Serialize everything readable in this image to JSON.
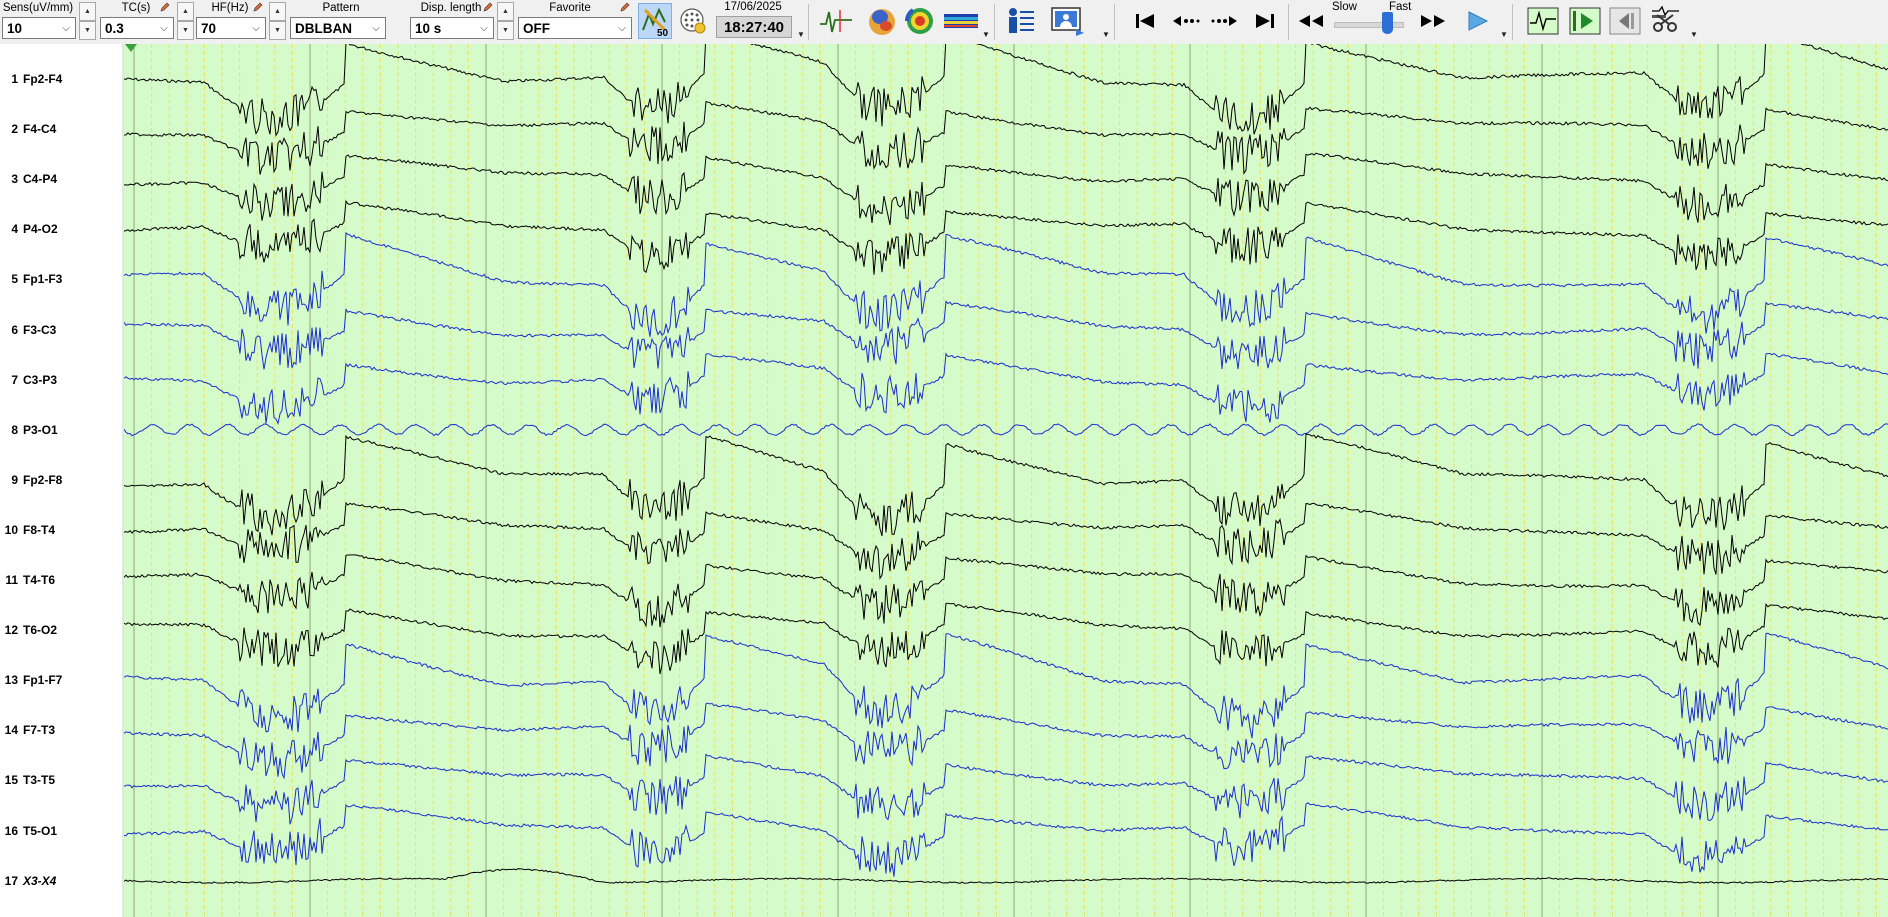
{
  "toolbar": {
    "sens": {
      "label": "Sens(uV/mm)",
      "value": "10"
    },
    "tc": {
      "label": "TC(s)",
      "value": "0.3"
    },
    "hf": {
      "label": "HF(Hz)",
      "value": "70"
    },
    "pattern": {
      "label": "Pattern",
      "value": "DBLBAN"
    },
    "display_length": {
      "label": "Disp. length",
      "value": "10 s"
    },
    "favorite": {
      "label": "Favorite",
      "value": "OFF"
    },
    "notch_badge": "50",
    "date": "17/06/2025",
    "time": "18:27:40",
    "speed": {
      "slow_label": "Slow",
      "fast_label": "Fast",
      "level": 0.78
    },
    "icons": [
      "filter-50hz-icon",
      "electrode-grid-icon",
      "spike-icon",
      "head-map-icon",
      "topography-icon",
      "spectrum-icon",
      "patient-info-icon",
      "video-icon",
      "go-start-icon",
      "prev-page-icon",
      "next-page-icon",
      "go-end-icon",
      "rewind-icon",
      "fast-forward-icon",
      "play-icon",
      "trace-view-icon",
      "trace-play-icon",
      "previous-icon",
      "settings-tools-icon"
    ]
  },
  "channels": [
    {
      "index": "1",
      "name": "Fp2-F4",
      "color": "#000000"
    },
    {
      "index": "2",
      "name": "F4-C4",
      "color": "#000000"
    },
    {
      "index": "3",
      "name": "C4-P4",
      "color": "#000000"
    },
    {
      "index": "4",
      "name": "P4-O2",
      "color": "#000000"
    },
    {
      "index": "5",
      "name": "Fp1-F3",
      "color": "#1a2ecc"
    },
    {
      "index": "6",
      "name": "F3-C3",
      "color": "#1a2ecc"
    },
    {
      "index": "7",
      "name": "C3-P3",
      "color": "#1a2ecc"
    },
    {
      "index": "8",
      "name": "P3-O1",
      "color": "#1a2ecc"
    },
    {
      "index": "9",
      "name": "Fp2-F8",
      "color": "#000000"
    },
    {
      "index": "10",
      "name": "F8-T4",
      "color": "#000000"
    },
    {
      "index": "11",
      "name": "T4-T6",
      "color": "#000000"
    },
    {
      "index": "12",
      "name": "T6-O2",
      "color": "#000000"
    },
    {
      "index": "13",
      "name": "Fp1-F7",
      "color": "#1a2ecc"
    },
    {
      "index": "14",
      "name": "F7-T3",
      "color": "#1a2ecc"
    },
    {
      "index": "15",
      "name": "T3-T5",
      "color": "#1a2ecc"
    },
    {
      "index": "16",
      "name": "T5-O1",
      "color": "#1a2ecc"
    },
    {
      "index": "17",
      "name": "X3-X4",
      "color": "#000000"
    }
  ],
  "colors": {
    "plot_background": "#d6fbcb",
    "second_gridline": "#8ea86f",
    "subsecond_gridline": "#e7e35a",
    "trace_black": "#000000",
    "trace_blue": "#1a2ecc"
  }
}
